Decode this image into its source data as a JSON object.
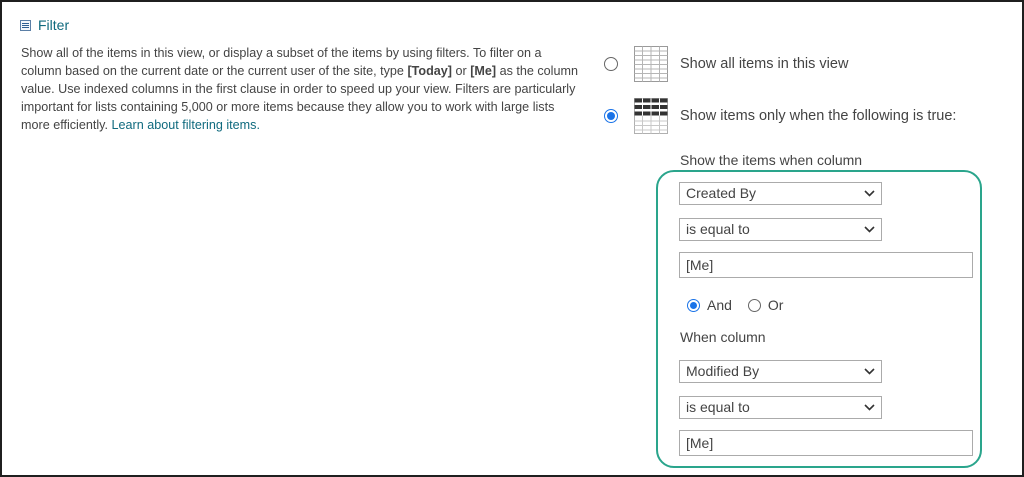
{
  "section": {
    "title": "Filter",
    "description": {
      "part1": "Show all of the items in this view, or display a subset of the items by using filters. To filter on a column based on the current date or the current user of the site, type ",
      "today": "[Today]",
      "part2": " or ",
      "me": "[Me]",
      "part3": " as the column value. Use indexed columns in the first clause in order to speed up your view. Filters are particularly important for lists containing 5,000 or more items because they allow you to work with large lists more efficiently. ",
      "link": "Learn about filtering items."
    }
  },
  "options": {
    "show_all": {
      "label": "Show all items in this view",
      "selected": false
    },
    "show_filtered": {
      "label": "Show items only when the following is true:",
      "selected": true
    }
  },
  "filter": {
    "first_label": "Show the items when column",
    "clause1": {
      "column": "Created By",
      "operator": "is equal to",
      "value": "[Me]"
    },
    "connector": {
      "and_label": "And",
      "or_label": "Or",
      "selected": "And"
    },
    "second_label": "When column",
    "clause2": {
      "column": "Modified By",
      "operator": "is equal to",
      "value": "[Me]"
    }
  },
  "icons": {
    "collapse": "collapse-minus-icon",
    "table_all": "table-grid-icon",
    "table_filtered": "table-filter-icon",
    "dropdown": "chevron-down-icon"
  },
  "colors": {
    "link": "#0f6a7e",
    "highlight": "#2aa58c",
    "radio_selected": "#1a73e8"
  }
}
